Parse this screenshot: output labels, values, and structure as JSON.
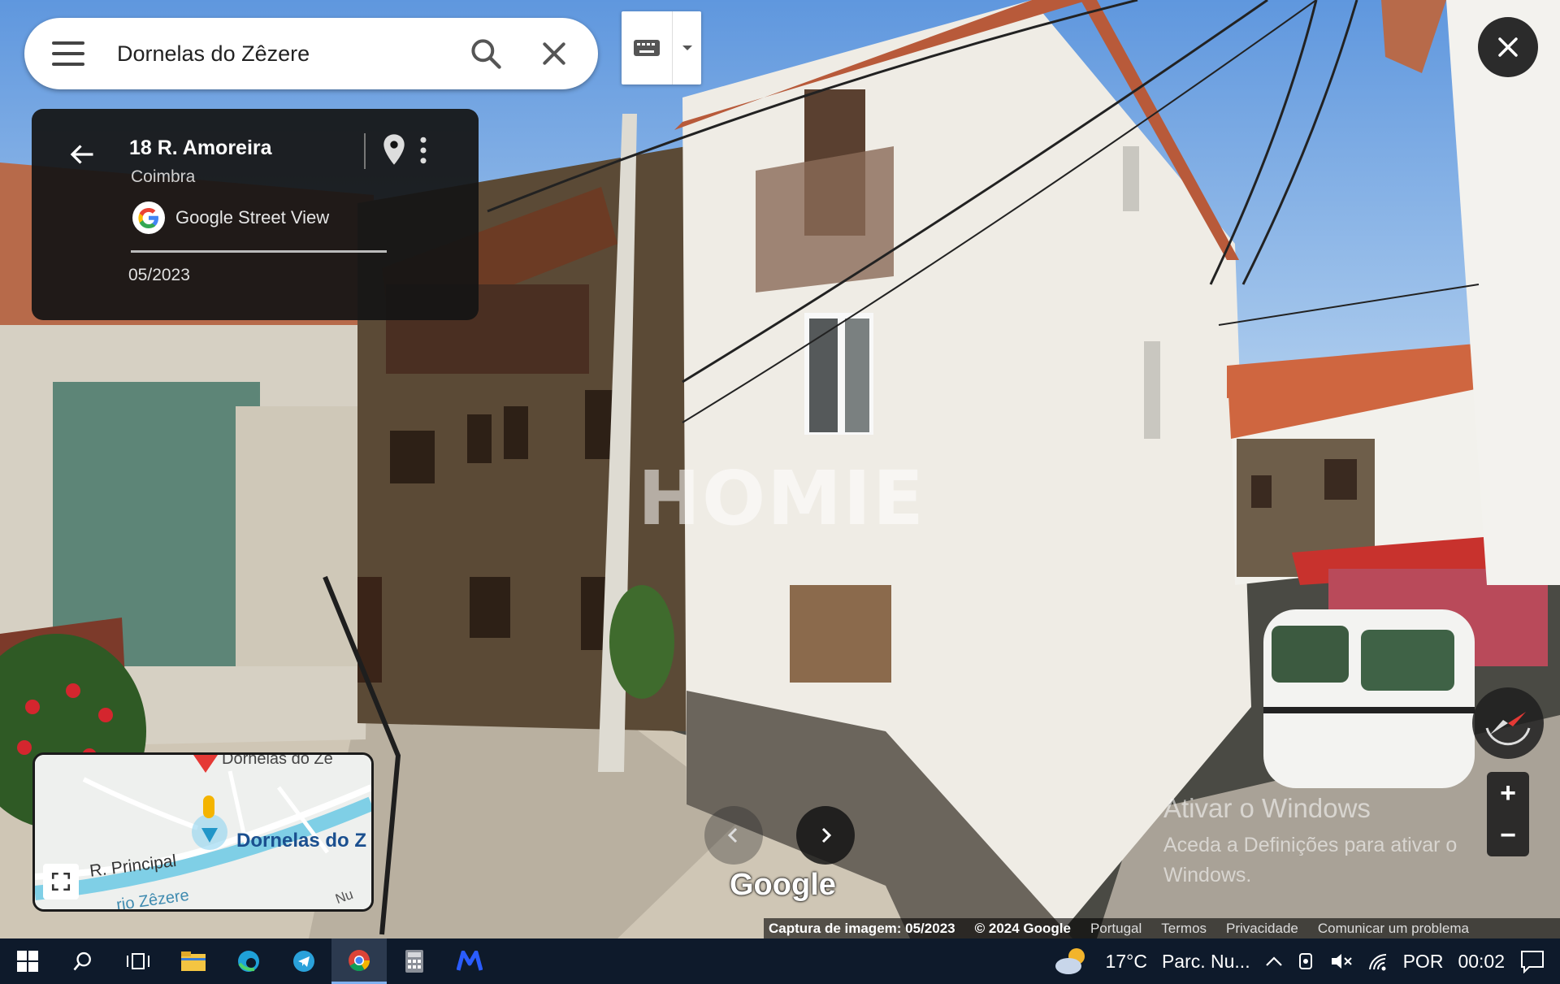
{
  "search": {
    "query": "Dornelas do Zêzere"
  },
  "card": {
    "address": "18 R. Amoreira",
    "city": "Coimbra",
    "source": "Google Street View",
    "date": "05/2023"
  },
  "watermark": "HOMIE",
  "minimap": {
    "town_label": "Dornelas do Z",
    "top_label": "Dornelas do Ze",
    "street_label": "R. Principal",
    "river_label": "rio Zêzere",
    "other_label": "Nu"
  },
  "google_logo": "Google",
  "activation": {
    "title": "Ativar o Windows",
    "subtitle": "Aceda a Definições para ativar o Windows."
  },
  "footer": {
    "capture": "Captura de imagem: 05/2023",
    "copyright": "© 2024 Google",
    "country": "Portugal",
    "terms": "Termos",
    "privacy": "Privacidade",
    "report": "Comunicar um problema"
  },
  "zoom": {
    "in": "+",
    "out": "−"
  },
  "taskbar": {
    "weather_temp": "17°C",
    "weather_text": "Parc. Nu...",
    "language": "POR",
    "time": "00:02"
  },
  "colors": {
    "sky": "#7fb0e6",
    "taskbar": "#0e1a2b",
    "card_bg": "#141414",
    "roof": "#c9603a"
  }
}
